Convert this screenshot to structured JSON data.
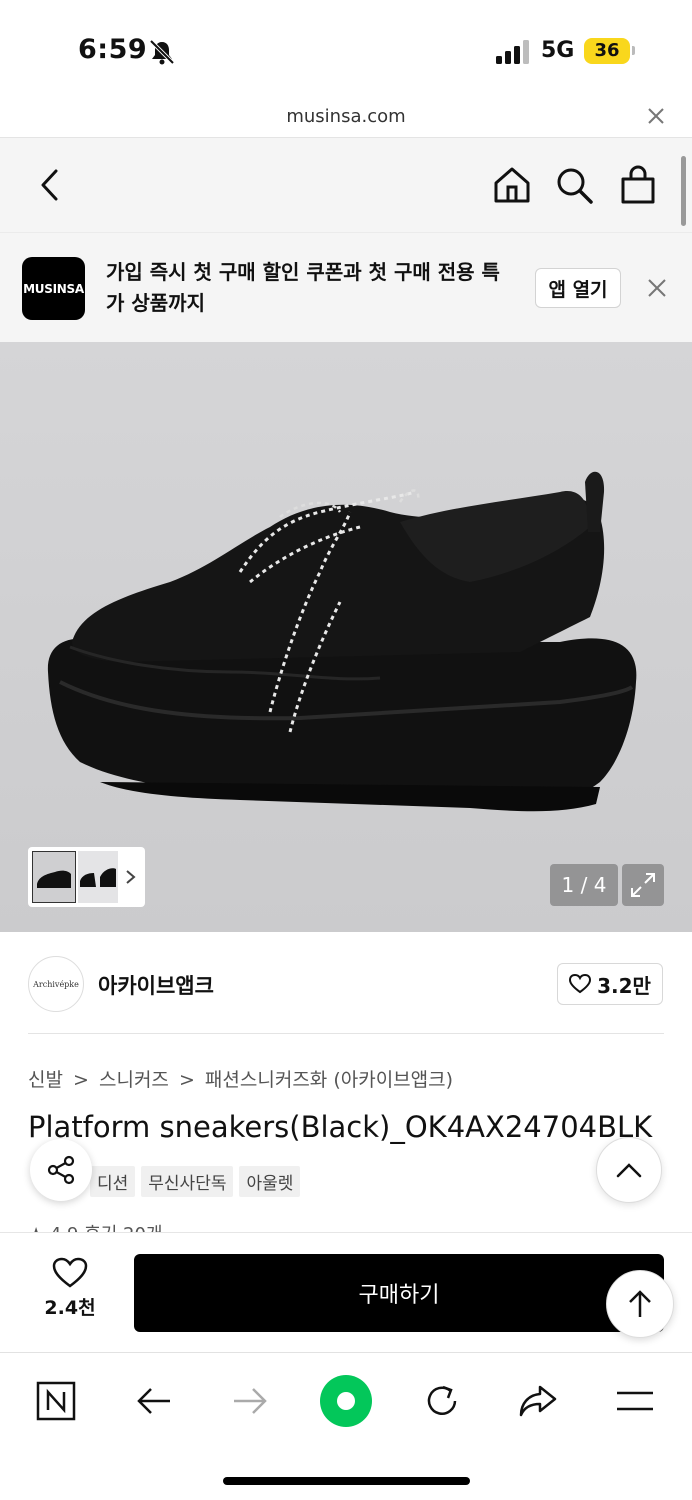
{
  "status": {
    "time": "6:59",
    "network": "5G",
    "battery": "36"
  },
  "browser": {
    "url": "musinsa.com"
  },
  "banner": {
    "logo_text": "MUSINSA",
    "message": "가입 즉시 첫 구매 할인 쿠폰과 첫 구매 전용 특가 상품까지",
    "open_app_label": "앱 열기"
  },
  "gallery": {
    "counter": "1 / 4"
  },
  "brand": {
    "logo_text": "Archivépke",
    "name": "아카이브앱크",
    "likes": "3.2만"
  },
  "breadcrumb": [
    "신발",
    "스니커즈",
    "패션스니커즈화 (아카이브앱크)"
  ],
  "breadcrumb_sep": ">",
  "product": {
    "title": "Platform sneakers(Black)_OK4AX24704BLK",
    "tags": [
      "디션",
      "무신사단독",
      "아울렛"
    ],
    "rating_peek": "★ 4.9  후기 20개"
  },
  "purchase": {
    "wish_count": "2.4천",
    "buy_label": "구매하기"
  },
  "colors": {
    "accent": "#000000",
    "naver_green": "#03c75a",
    "battery": "#f9d71c"
  }
}
